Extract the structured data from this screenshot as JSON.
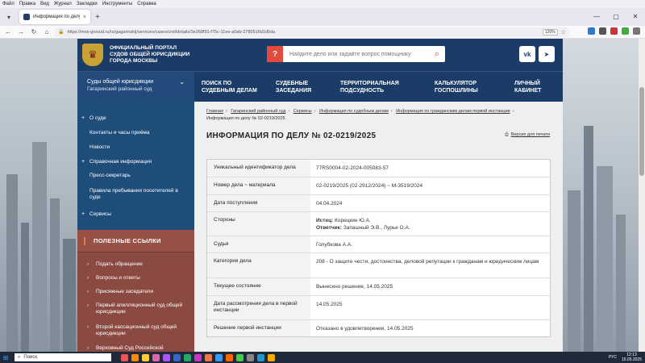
{
  "browser": {
    "menu": [
      "Файл",
      "Правка",
      "Вид",
      "Журнал",
      "Закладки",
      "Инструменты",
      "Справка"
    ],
    "tab_title": "Информация по делу № 02-0",
    "url": "https://mos-gorsud.ru/rs/gagarinskij/services/cases/civil/details/3e268f91-f75c-11ee-a0ab-2780516d1d5da",
    "zoom": "120%"
  },
  "header": {
    "portal_name": [
      "Официальный портал",
      "судов общей юрисдикции",
      "города Москвы"
    ],
    "search_placeholder": "Найдите дело или задайте вопрос помощнику",
    "alert_glyph": "?",
    "search_glyph": "⌕",
    "vk_label": "vk",
    "tg_glyph": "➤"
  },
  "nav": {
    "court_title": "Суды общей юрисдикции",
    "court_sub": "Гагаринский районный суд",
    "items": [
      [
        "Поиск по",
        "судебным делам"
      ],
      [
        "Судебные",
        "заседания"
      ],
      [
        "Территориальная",
        "подсудность"
      ],
      [
        "Калькулятор",
        "госпошлины"
      ],
      [
        "Личный",
        "кабинет"
      ]
    ]
  },
  "sidebar": {
    "items": [
      {
        "label": "О суде",
        "bullet": "+"
      },
      {
        "label": "Контакты и часы приёма",
        "bullet": ""
      },
      {
        "label": "Новости",
        "bullet": ""
      },
      {
        "label": "Справочная информация",
        "bullet": "+"
      },
      {
        "label": "Пресс-секретарь",
        "bullet": ""
      },
      {
        "label": "Правила пребывания посетителей в суде",
        "bullet": ""
      },
      {
        "label": "Сервисы",
        "bullet": "+"
      }
    ],
    "useful_title": "Полезные ссылки",
    "useful_items": [
      "Подать обращение",
      "Вопросы и ответы",
      "Присяжные заседатели",
      "Первый апелляционный суд общей юрисдикции",
      "Второй кассационный суд общей юрисдикции",
      "Верховный Суд Российской Федерации"
    ]
  },
  "content": {
    "breadcrumbs": [
      "Главная",
      "Гагаринский районный суд",
      "Сервисы",
      "Информация по судебным делам",
      "Информация по гражданским делам первой инстанции"
    ],
    "breadcrumb_current": "Информация по делу № 02-0219/2025",
    "title": "Информация по делу № 02-0219/2025",
    "print_label": "Версия для печати",
    "rows": [
      {
        "label": "Уникальный идентификатор дела",
        "value": "77RS0004-02-2024-005083-57"
      },
      {
        "label": "Номер дела ~ материала",
        "value": "02-0219/2025 (02-2912/2024) ~ М-3519/2024"
      },
      {
        "label": "Дата поступления",
        "value": "04.04.2024"
      },
      {
        "label": "Стороны",
        "plaintiff_label": "Истец:",
        "plaintiff": "Корецкин Ю.А.",
        "defendant_label": "Ответчик:",
        "defendant": "Запашный Э.В., Лурье О.А."
      },
      {
        "label": "Судья",
        "value": "Голубкова А.А."
      },
      {
        "label": "Категория дела",
        "value": "208 - О защите чести, достоинства, деловой репутации к гражданам и юридическим лицам"
      },
      {
        "label": "Текущее состояние",
        "value": "Вынесено решение, 14.05.2025"
      },
      {
        "label": "Дата рассмотрения дела в первой инстанции",
        "value": "14.05.2025"
      },
      {
        "label": "Решение первой инстанции",
        "value": "Отказано в удовлетворении, 14.05.2025"
      }
    ]
  },
  "taskbar": {
    "search_placeholder": "Поиск",
    "lang": "РУС",
    "time": "12:13",
    "date": "15.05.2025"
  }
}
